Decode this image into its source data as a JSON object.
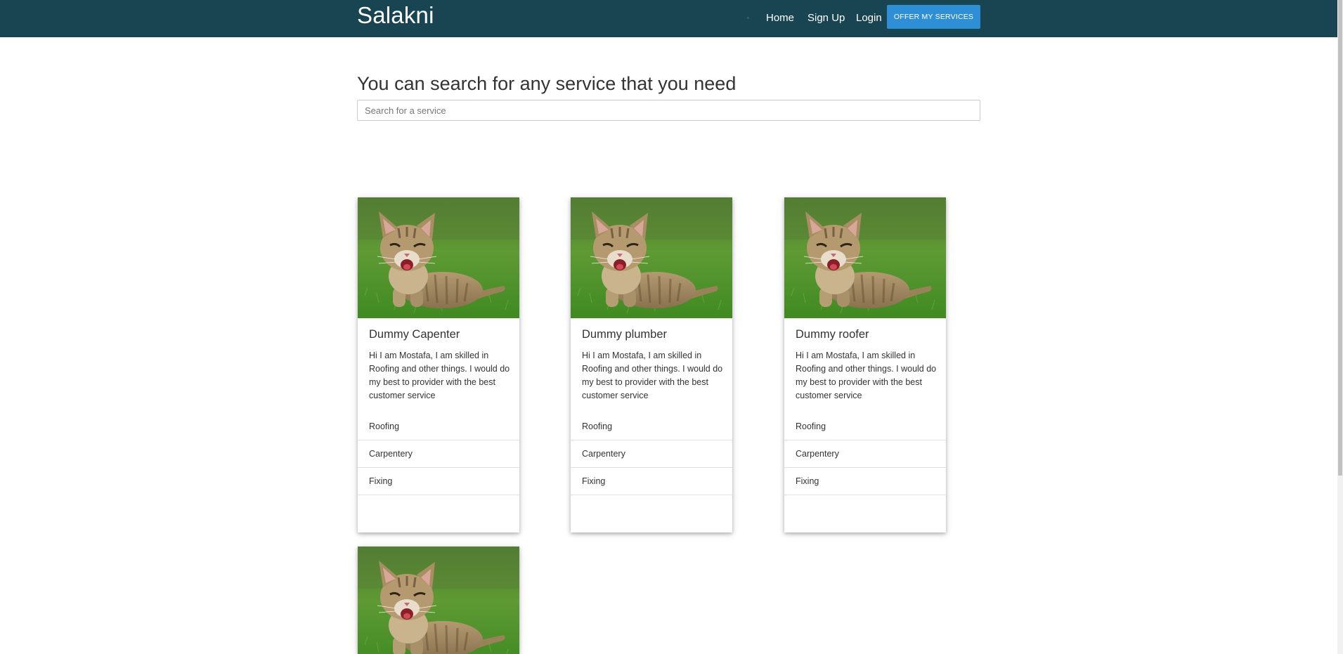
{
  "navbar": {
    "brand": "Salakni",
    "links": [
      "Home",
      "Sign Up",
      "Login"
    ],
    "offer_button": "OFFER MY SERVICES",
    "background_color": "#194553",
    "button_color": "#2e8fd6"
  },
  "search": {
    "heading": "You can search for any service that you need",
    "placeholder": "Search for a service",
    "value": ""
  },
  "cards": [
    {
      "title": "Dummy Capenter",
      "description": "Hi I am Mostafa, I am skilled in Roofing and other things. I would do my best to provider with the best customer service",
      "tags": [
        "Roofing",
        "Carpentery",
        "Fixing"
      ],
      "image": "kitten-in-grass"
    },
    {
      "title": "Dummy plumber",
      "description": "Hi I am Mostafa, I am skilled in Roofing and other things. I would do my best to provider with the best customer service",
      "tags": [
        "Roofing",
        "Carpentery",
        "Fixing"
      ],
      "image": "kitten-in-grass"
    },
    {
      "title": "Dummy roofer",
      "description": "Hi I am Mostafa, I am skilled in Roofing and other things. I would do my best to provider with the best customer service",
      "tags": [
        "Roofing",
        "Carpentery",
        "Fixing"
      ],
      "image": "kitten-in-grass"
    },
    {
      "title": "",
      "description": "",
      "tags": [],
      "image": "kitten-in-grass"
    }
  ]
}
